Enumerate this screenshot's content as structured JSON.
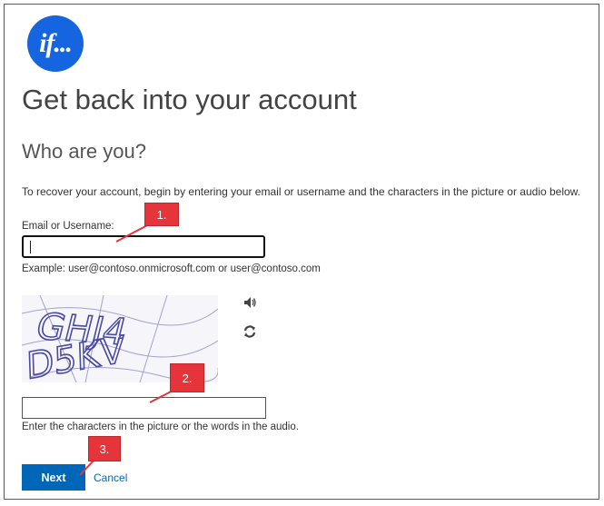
{
  "logo": {
    "text": "if..."
  },
  "page": {
    "title": "Get back into your account",
    "subtitle": "Who are you?",
    "instructions": "To recover your account, begin by entering your email or username and the characters in the picture or audio below."
  },
  "email": {
    "label": "Email or Username:",
    "value": "",
    "example": "Example: user@contoso.onmicrosoft.com or user@contoso.com"
  },
  "captcha": {
    "line1": "GHJ4",
    "line2": "D5KV",
    "input_value": "",
    "hint": "Enter the characters in the picture or the words in the audio."
  },
  "icons": {
    "audio": "speaker-icon",
    "refresh": "refresh-icon"
  },
  "actions": {
    "next_label": "Next",
    "cancel_label": "Cancel"
  },
  "callouts": {
    "c1": "1.",
    "c2": "2.",
    "c3": "3."
  },
  "colors": {
    "brand": "#1565e0",
    "accent": "#0067b8",
    "callout": "#e5353b"
  }
}
